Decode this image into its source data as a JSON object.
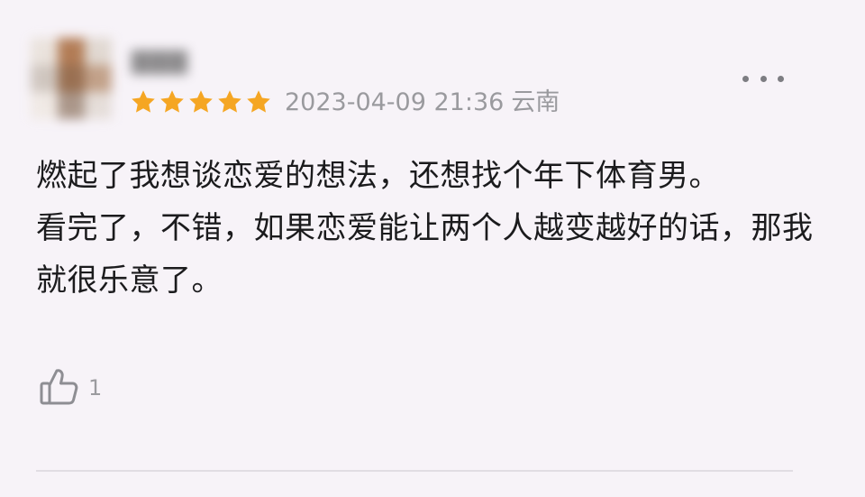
{
  "review": {
    "username": "▇▇▇",
    "rating": 5,
    "date": "2023-04-09 21:36",
    "location": "云南",
    "paragraphs": [
      "燃起了我想谈恋爱的想法，还想找个年下体育男。",
      "看完了，不错，如果恋爱能让两个人越变越好的话，那我就很乐意了。"
    ],
    "like_count": "1",
    "colors": {
      "star": "#f5a623",
      "meta_text": "#9a9a9e",
      "body_text": "#1b1b1d",
      "background": "#f7f3f8"
    },
    "icons": {
      "rating": "star-icon",
      "like": "thumbs-up-icon",
      "more": "more-dots-icon"
    }
  }
}
